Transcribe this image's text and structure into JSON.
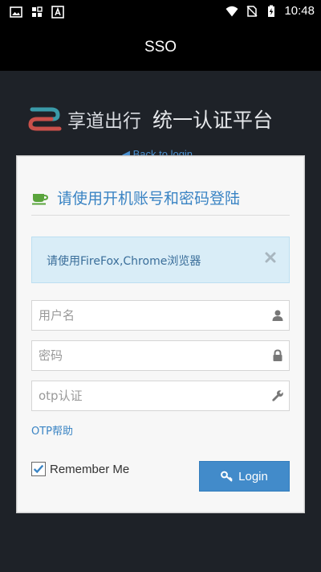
{
  "status_bar": {
    "time": "10:48",
    "icons": [
      "image-icon",
      "grid-app-icon",
      "text-app-icon",
      "wifi-icon",
      "no-sim-icon",
      "battery-charging-icon"
    ]
  },
  "app_bar": {
    "title": "SSO"
  },
  "brand": {
    "name": "享道出行",
    "title": "统一认证平台",
    "logo_colors": [
      "#3a9aa8",
      "#c9504a"
    ]
  },
  "back_link": "Back to login",
  "card": {
    "heading": "请使用开机账号和密码登陆",
    "heading_icon": "coffee-cup-icon",
    "alert": {
      "text": "请使用FireFox,Chrome浏览器",
      "close_icon": "close-icon"
    },
    "fields": {
      "username": {
        "placeholder": "用户名",
        "value": "",
        "icon": "user-icon"
      },
      "password": {
        "placeholder": "密码",
        "value": "",
        "icon": "lock-icon"
      },
      "otp": {
        "placeholder": "otp认证",
        "value": "",
        "icon": "wrench-icon"
      }
    },
    "otp_help": "OTP帮助",
    "remember": {
      "label": "Remember Me",
      "checked": true
    },
    "login_button": {
      "label": "Login",
      "icon": "key-icon"
    }
  },
  "colors": {
    "background": "#1e2228",
    "accent": "#428bca",
    "alert_bg": "#d9edf7",
    "heading": "#3a84c4"
  }
}
